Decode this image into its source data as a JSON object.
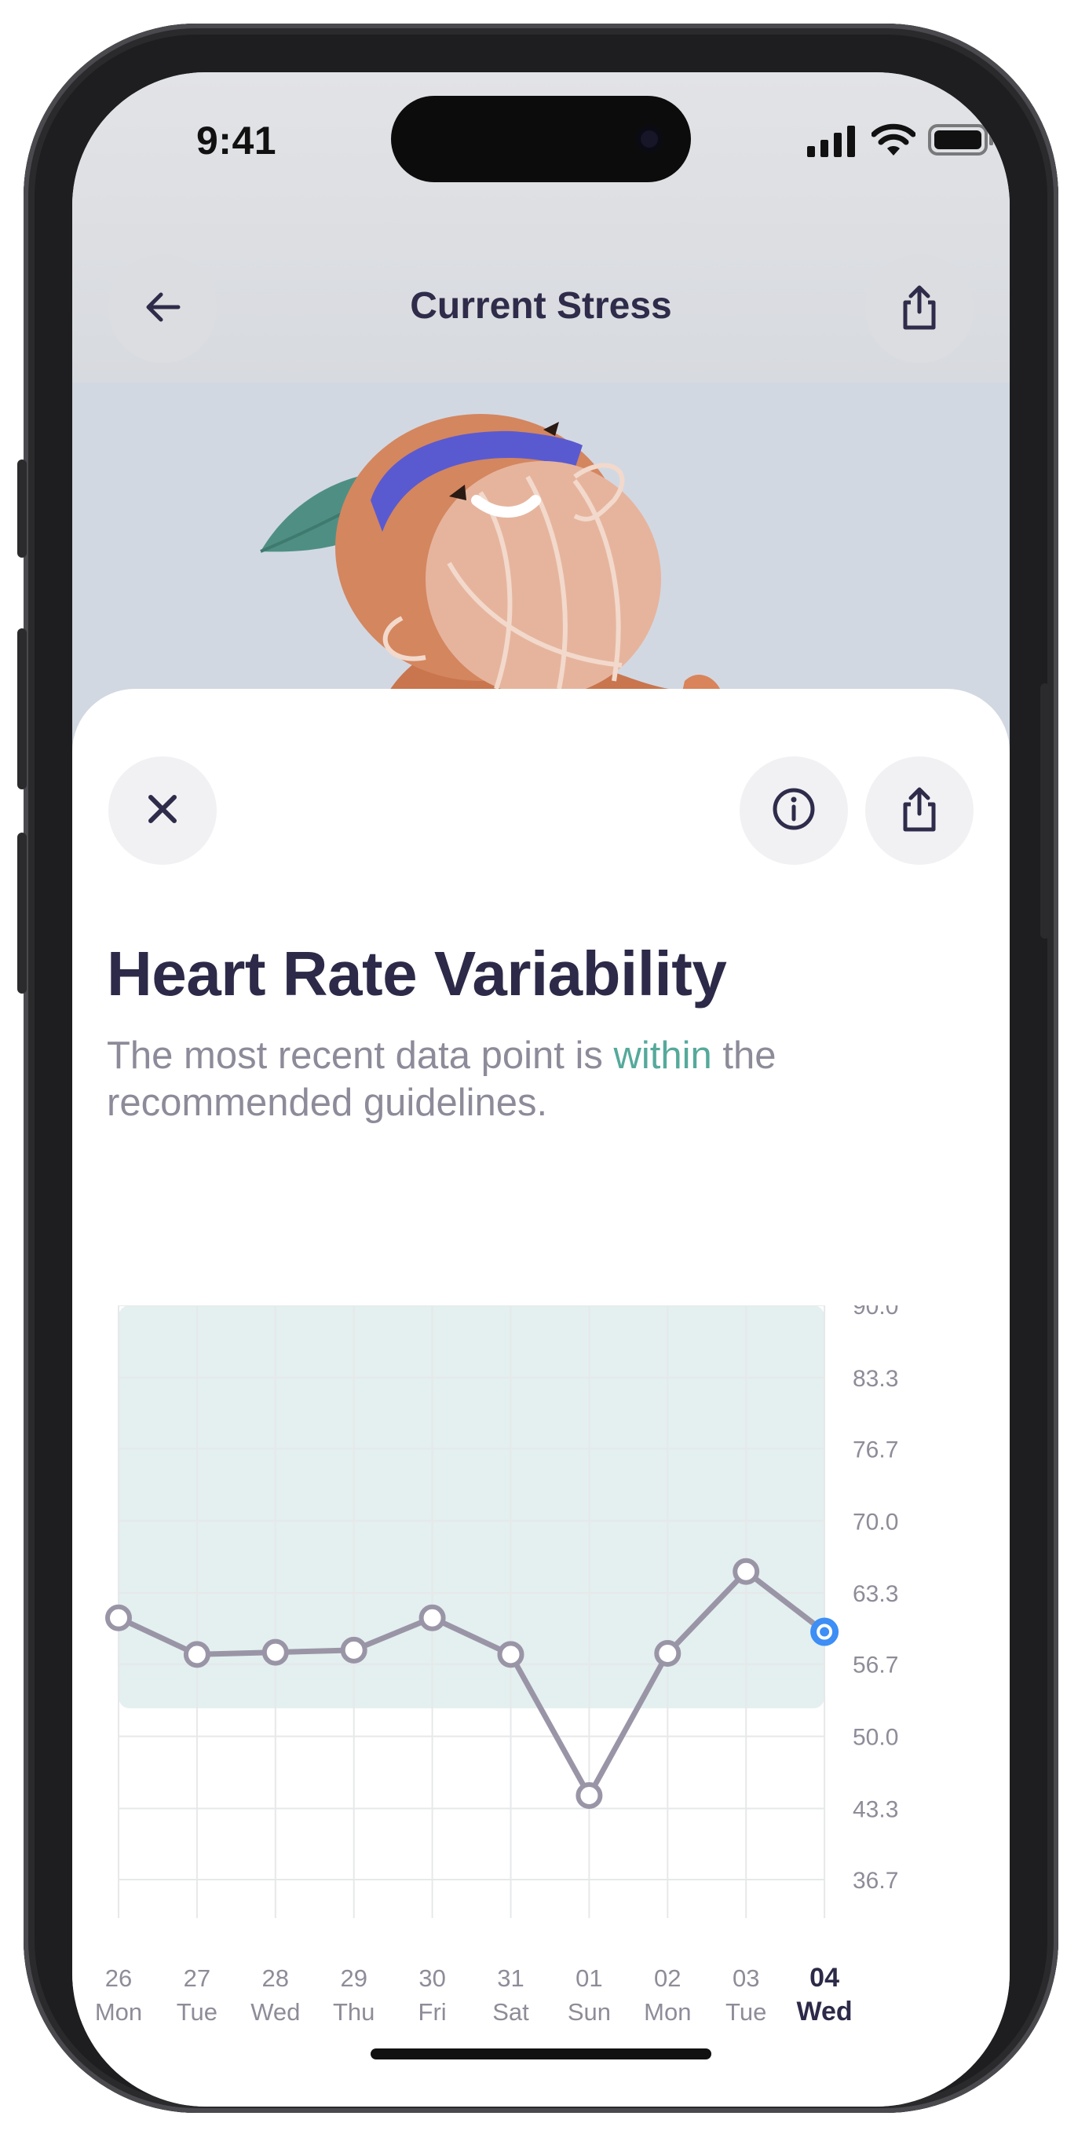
{
  "status_bar": {
    "time": "9:41"
  },
  "nav": {
    "title": "Current Stress"
  },
  "sheet": {
    "title": "Heart Rate Variability",
    "subtitle_before": "The most recent data point is ",
    "subtitle_highlight": "within",
    "subtitle_after": " the recommended guidelines."
  },
  "icons": {
    "back": "arrow-left-icon",
    "share": "share-icon",
    "close": "close-icon",
    "info": "info-icon"
  },
  "colors": {
    "accent_text": "#55a99b",
    "title": "#2c2a48",
    "range_band": "#e3f0ef",
    "line": "#9a95a6",
    "selected_point": "#3d8ef5"
  },
  "chart_data": {
    "type": "line",
    "title": "",
    "xlabel": "",
    "ylabel": "",
    "categories": [
      {
        "day": "26",
        "weekday": "Mon"
      },
      {
        "day": "27",
        "weekday": "Tue"
      },
      {
        "day": "28",
        "weekday": "Wed"
      },
      {
        "day": "29",
        "weekday": "Thu"
      },
      {
        "day": "30",
        "weekday": "Fri"
      },
      {
        "day": "31",
        "weekday": "Sat"
      },
      {
        "day": "01",
        "weekday": "Sun"
      },
      {
        "day": "02",
        "weekday": "Mon"
      },
      {
        "day": "03",
        "weekday": "Tue"
      },
      {
        "day": "04",
        "weekday": "Wed"
      }
    ],
    "values": [
      61.0,
      57.6,
      57.8,
      58.0,
      61.0,
      57.6,
      44.5,
      57.7,
      65.3,
      59.7
    ],
    "yticks": [
      "90.0",
      "83.3",
      "76.7",
      "70.0",
      "63.3",
      "56.7",
      "50.0",
      "43.3",
      "36.7"
    ],
    "ylim": [
      36.7,
      90.0
    ],
    "recommended_range": [
      52.6,
      90.0
    ],
    "selected_index": 9,
    "grid": true,
    "y_axis_side": "right"
  }
}
